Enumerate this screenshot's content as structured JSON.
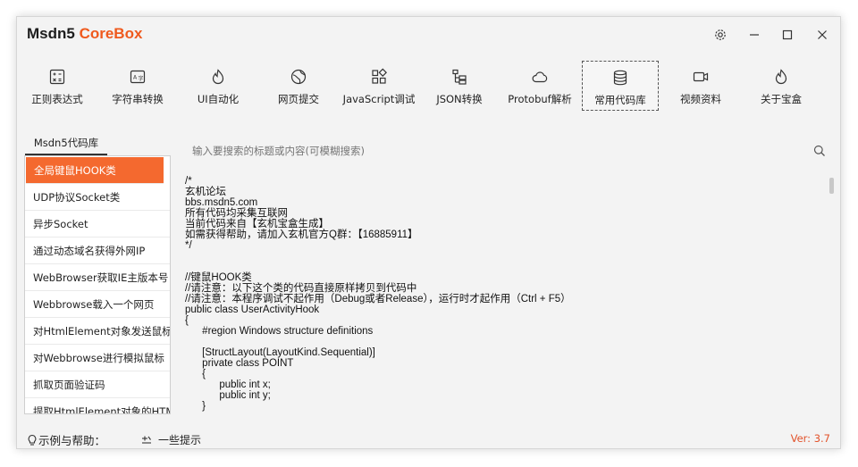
{
  "app": {
    "title_main": "Msdn5",
    "title_accent": "CoreBox",
    "colors": {
      "accent": "#ef5a1e",
      "selected": "#f4692f",
      "version": "#e2522a"
    }
  },
  "toolbar": {
    "items": [
      {
        "label": "正则表达式",
        "icon": "regex-calculator-icon"
      },
      {
        "label": "字符串转换",
        "icon": "string-convert-icon"
      },
      {
        "label": "UI自动化",
        "icon": "flame-icon"
      },
      {
        "label": "网页提交",
        "icon": "web-globe-icon"
      },
      {
        "label": "JavaScript调试",
        "icon": "javascript-grid-icon"
      },
      {
        "label": "JSON转换",
        "icon": "json-tree-icon"
      },
      {
        "label": "Protobuf解析",
        "icon": "cloud-icon"
      },
      {
        "label": "常用代码库",
        "icon": "database-icon"
      },
      {
        "label": "视频资料",
        "icon": "video-camera-icon"
      },
      {
        "label": "关于宝盒",
        "icon": "flame-icon"
      }
    ],
    "active_index": 7
  },
  "sidebar": {
    "tab": "Msdn5代码库",
    "items": [
      "全局键鼠HOOK类",
      "UDP协议Socket类",
      "异步Socket",
      "通过动态域名获得外网IP",
      "WebBrowser获取IE主版本号",
      "Webbrowse载入一个网页",
      "对HtmlElement对象发送鼠标",
      "对Webbrowse进行模拟鼠标",
      "抓取页面验证码",
      "提取HtmlElement对象的HTML"
    ],
    "selected_index": 0
  },
  "search": {
    "placeholder": "输入要搜索的标题或内容(可模糊搜索)"
  },
  "code": {
    "text": "/*\n玄机论坛\nbbs.msdn5.com\n所有代码均采集互联网\n当前代码来自【玄机宝盒生成】\n如需获得帮助，请加入玄机官方Q群：【16885911】\n*/\n\n\n//键鼠HOOK类\n//请注意：以下这个类的代码直接原样拷贝到代码中\n//请注意：本程序调试不起作用（Debug或者Release），运行时才起作用（Ctrl + F5）\npublic class UserActivityHook\n{\n      #region Windows structure definitions\n\n      [StructLayout(LayoutKind.Sequential)]\n      private class POINT\n      {\n            public int x;\n            public int y;\n      }"
  },
  "footer": {
    "help": "示例与帮助：",
    "tip": "一些提示",
    "version": "Ver: 3.7"
  }
}
